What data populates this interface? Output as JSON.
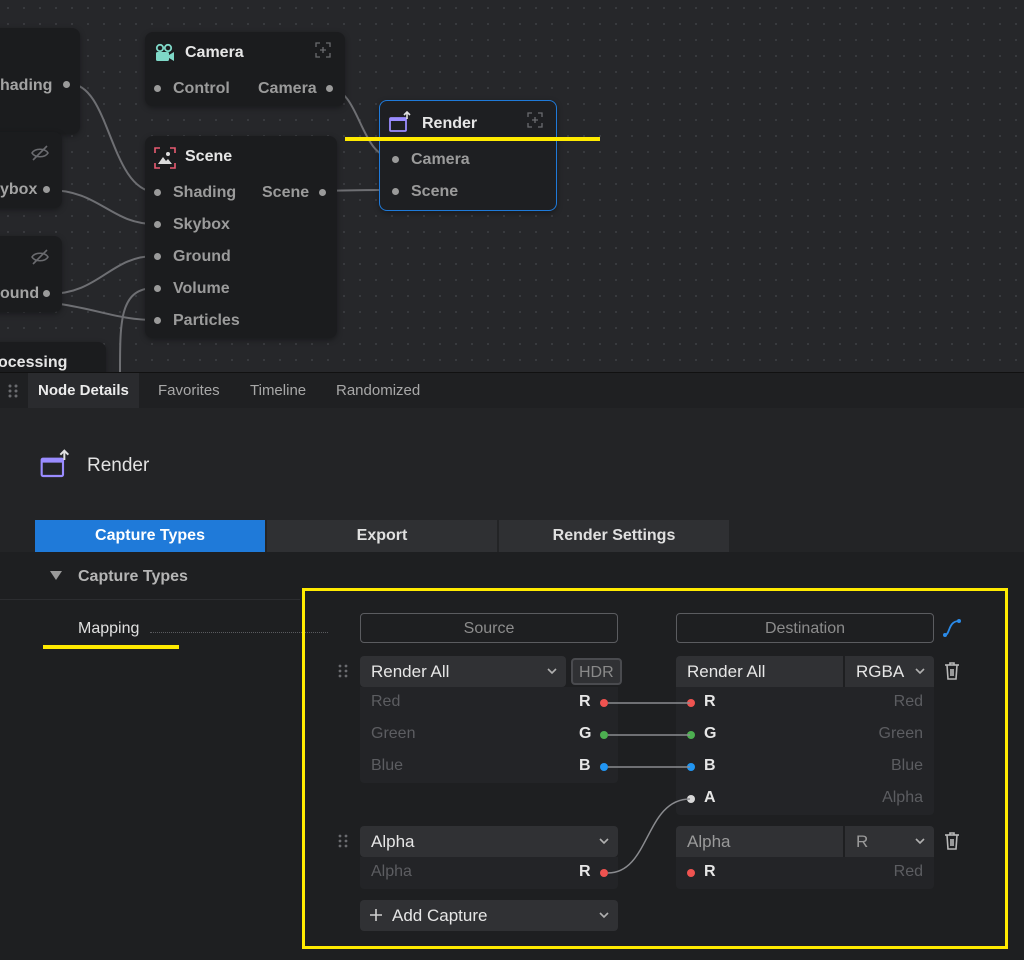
{
  "graph": {
    "left_nodes": {
      "shading_port": "hading",
      "skybox_port": "ybox",
      "ground_port": "ound",
      "processing_title": "ocessing"
    },
    "camera_node": {
      "title": "Camera",
      "port_in": "Control",
      "port_out": "Camera"
    },
    "scene_node": {
      "title": "Scene",
      "inputs": [
        "Shading",
        "Skybox",
        "Ground",
        "Volume",
        "Particles"
      ],
      "output": "Scene"
    },
    "render_node": {
      "title": "Render",
      "inputs": [
        "Camera",
        "Scene"
      ]
    }
  },
  "tabs": [
    "Node Details",
    "Favorites",
    "Timeline",
    "Randomized"
  ],
  "details": {
    "title": "Render",
    "sub_tabs": [
      "Capture Types",
      "Export",
      "Render Settings"
    ],
    "section_title": "Capture Types",
    "mapping_label": "Mapping",
    "source_header": "Source",
    "destination_header": "Destination",
    "capture1": {
      "source_select": "Render All",
      "hdr_badge": "HDR",
      "source_channels": [
        {
          "name": "Red",
          "letter": "R"
        },
        {
          "name": "Green",
          "letter": "G"
        },
        {
          "name": "Blue",
          "letter": "B"
        }
      ],
      "dest_select": "Render All",
      "dest_format": "RGBA",
      "dest_channels": [
        {
          "letter": "R",
          "name": "Red"
        },
        {
          "letter": "G",
          "name": "Green"
        },
        {
          "letter": "B",
          "name": "Blue"
        },
        {
          "letter": "A",
          "name": "Alpha"
        }
      ]
    },
    "capture2": {
      "source_select": "Alpha",
      "source_channels": [
        {
          "name": "Alpha",
          "letter": "R"
        }
      ],
      "dest_select": "Alpha",
      "dest_format": "R",
      "dest_channels": [
        {
          "letter": "R",
          "name": "Red"
        }
      ]
    },
    "add_capture_label": "Add Capture"
  },
  "colors": {
    "accent": "#1f7ad9",
    "highlight": "#ffea00",
    "red": "#ef5350",
    "green": "#4caf50",
    "blue": "#2196f3",
    "alpha": "#d8d8d8"
  },
  "icons": {
    "camera_node": "camera-node-icon",
    "scene_node": "scene-node-icon",
    "render_node": "render-clapper-icon",
    "expand": "expand-icon",
    "visibility_off": "eye-off-icon",
    "grip": "drag-grip-icon",
    "trash": "trash-icon",
    "curve": "curve-link-icon",
    "plus": "plus-icon",
    "chevron": "chevron-down-icon",
    "collapse": "triangle-down-icon"
  }
}
